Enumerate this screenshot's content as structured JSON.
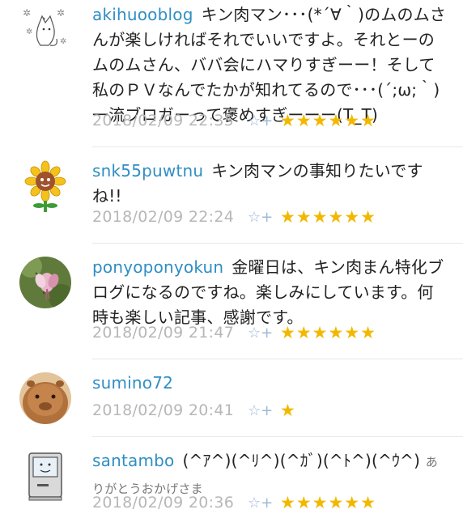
{
  "comments": [
    {
      "user": "akihuooblog",
      "text": "キン肉マン･･･(*´∀｀)のムのムさんが楽しければそれでいいですよ。それとーのムのムさん、ババ会にハマりすぎーー！そして私のＰＶなんでたかが知れてるので･･･(´;ω;｀)一流ブロガーって褒めすぎーーー(T_T)",
      "date": "2018/02/09 22:35",
      "star_add": "☆+",
      "stars": "★★★★★★"
    },
    {
      "user": "snk55puwtnu",
      "text": "キン肉マンの事知りたいですね!!",
      "date": "2018/02/09 22:24",
      "star_add": "☆+",
      "stars": "★★★★★★"
    },
    {
      "user": "ponyoponyokun",
      "text": "金曜日は、キン肉まん特化ブログになるのですね。楽しみにしています。何時も楽しい記事、感謝です。",
      "date": "2018/02/09 21:47",
      "star_add": "☆+",
      "stars": "★★★★★★"
    },
    {
      "user": "sumino72",
      "text": "",
      "date": "2018/02/09 20:41",
      "star_add": "☆+",
      "stars": "★"
    },
    {
      "user": "santambo",
      "text": "(^ｱ^)(^ﾘ^)(^ｶﾞ)(^ﾄ^)(^ｳ^)",
      "sub": "ありがとうおかげさま",
      "date": "2018/02/09 20:36",
      "star_add": "☆+",
      "stars": "★★★★★★"
    }
  ],
  "colors": {
    "username": "#2f8ec4",
    "date": "#b7b7b7",
    "star": "#f2b800",
    "star_add": "#9db8d8"
  }
}
